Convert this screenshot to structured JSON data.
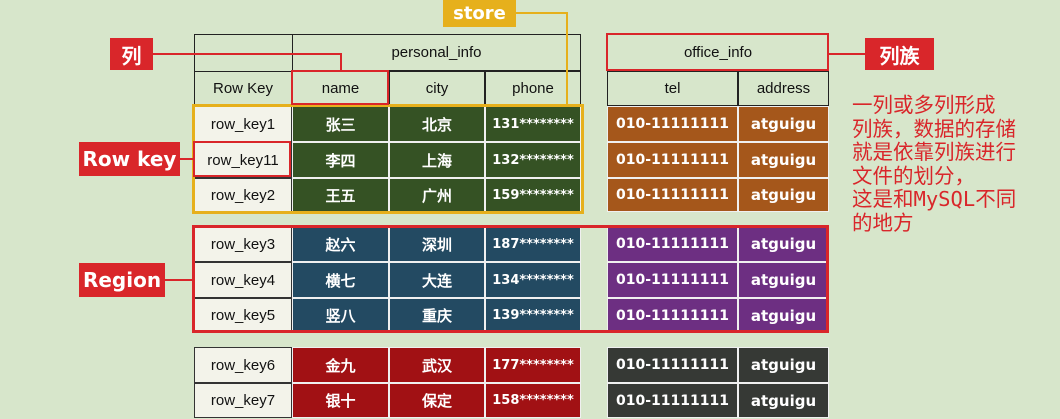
{
  "header": {
    "personal_info": "personal_info",
    "office_info": "office_info",
    "columns": [
      "Row Key",
      "name",
      "city",
      "phone",
      "tel",
      "address"
    ]
  },
  "rows": [
    {
      "key": "row_key1",
      "name": "张三",
      "city": "北京",
      "phone": "131********",
      "tel": "010-11111111",
      "address": "atguigu"
    },
    {
      "key": "row_key11",
      "name": "李四",
      "city": "上海",
      "phone": "132********",
      "tel": "010-11111111",
      "address": "atguigu"
    },
    {
      "key": "row_key2",
      "name": "王五",
      "city": "广州",
      "phone": "159********",
      "tel": "010-11111111",
      "address": "atguigu"
    },
    {
      "key": "row_key3",
      "name": "赵六",
      "city": "深圳",
      "phone": "187********",
      "tel": "010-11111111",
      "address": "atguigu"
    },
    {
      "key": "row_key4",
      "name": "横七",
      "city": "大连",
      "phone": "134********",
      "tel": "010-11111111",
      "address": "atguigu"
    },
    {
      "key": "row_key5",
      "name": "竖八",
      "city": "重庆",
      "phone": "139********",
      "tel": "010-11111111",
      "address": "atguigu"
    },
    {
      "key": "row_key6",
      "name": "金九",
      "city": "武汉",
      "phone": "177********",
      "tel": "010-11111111",
      "address": "atguigu"
    },
    {
      "key": "row_key7",
      "name": "银十",
      "city": "保定",
      "phone": "158********",
      "tel": "010-11111111",
      "address": "atguigu"
    }
  ],
  "groups": [
    {
      "personal_color": "#355224",
      "office_color": "#a5571b"
    },
    {
      "personal_color": "#234a62",
      "office_color": "#6d2f82"
    },
    {
      "personal_color": "#a11114",
      "office_color": "#363935"
    }
  ],
  "labels": {
    "store": "store",
    "column": "列",
    "column_family": "列族",
    "row_key": "Row key",
    "region": "Region"
  },
  "note": "一列或多列形成\n列族，数据的存储\n就是依靠列族进行\n文件的划分，\n这是和MySQL不同\n的地方",
  "colors": {
    "background": "#d7e6cb",
    "label_red": "#d9262a",
    "store_gold": "#e6b01c",
    "light_cell": "#f3f3ea"
  }
}
